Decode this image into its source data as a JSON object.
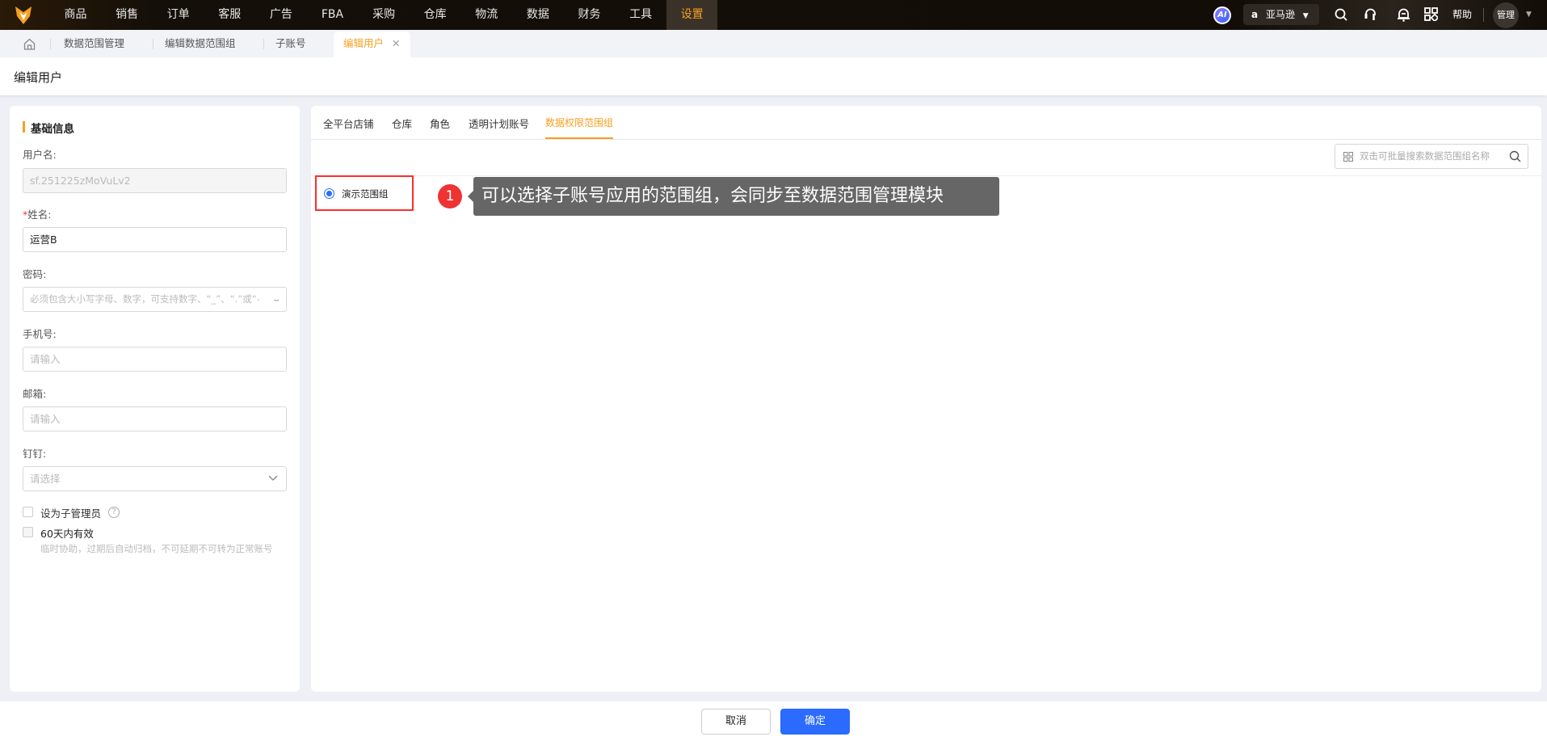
{
  "nav": {
    "items": [
      "商品",
      "销售",
      "订单",
      "客服",
      "广告",
      "FBA",
      "采购",
      "仓库",
      "物流",
      "数据",
      "财务",
      "工具",
      "设置"
    ],
    "active_index": 12,
    "ai_label": "AI",
    "marketplace": "亚马逊",
    "help": "帮助",
    "user": "管理"
  },
  "page_tabs": {
    "items": [
      "数据范围管理",
      "编辑数据范围组",
      "子账号"
    ],
    "active": "编辑用户"
  },
  "page_title": "编辑用户",
  "basic": {
    "section_title": "基础信息",
    "username_label": "用户名:",
    "username_value": "sf.251225zMoVuLv2",
    "required_mark": "*",
    "name_label": "姓名:",
    "name_value": "运营B",
    "password_label": "密码:",
    "password_placeholder": "必须包含大小写字母、数字，可支持数字、“_”、“.”或“-",
    "phone_label": "手机号:",
    "phone_placeholder": "请输入",
    "email_label": "邮箱:",
    "email_placeholder": "请输入",
    "dingtalk_label": "钉钉:",
    "dingtalk_placeholder": "请选择",
    "sub_admin_label": "设为子管理员",
    "temp_label": "60天内有效",
    "temp_hint": "临时协助，过期后自动归档，不可延期不可转为正常账号"
  },
  "right": {
    "tabs": [
      "全平台店铺",
      "仓库",
      "角色",
      "透明计划账号",
      "数据权限范围组"
    ],
    "active_index": 4,
    "search_placeholder": "双击可批量搜索数据范围组名称",
    "radio_option": "演示范围组"
  },
  "annotation": {
    "number": "1",
    "text": "可以选择子账号应用的范围组，会同步至数据范围管理模块"
  },
  "footer": {
    "cancel": "取消",
    "confirm": "确定"
  },
  "colors": {
    "accent": "#f5a020",
    "primary": "#2b6bff",
    "highlight": "#ff2d2d"
  }
}
